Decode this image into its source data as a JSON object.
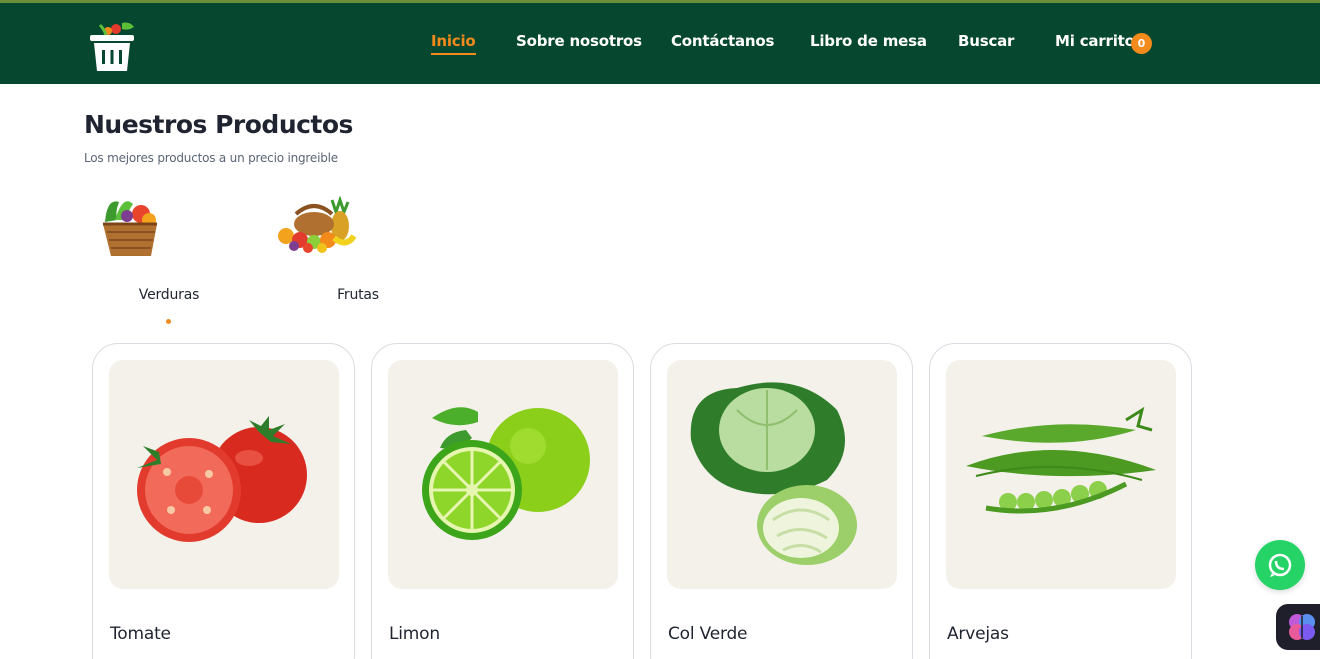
{
  "nav": {
    "items": [
      {
        "label": "Inicio",
        "active": true
      },
      {
        "label": "Sobre nosotros",
        "active": false
      },
      {
        "label": "Contáctanos",
        "active": false
      },
      {
        "label": "Libro de mesa",
        "active": false
      },
      {
        "label": "Buscar",
        "active": false
      },
      {
        "label": "Mi carrito",
        "active": false
      }
    ],
    "cart_count": "0"
  },
  "section": {
    "title": "Nuestros Productos",
    "subtitle": "Los mejores productos a un precio ingreible"
  },
  "categories": [
    {
      "label": "Verduras",
      "icon": "vegetable-basket-icon",
      "selected": true
    },
    {
      "label": "Frutas",
      "icon": "fruit-basket-icon",
      "selected": false
    }
  ],
  "products": [
    {
      "name": "Tomate",
      "image": "tomato-image"
    },
    {
      "name": "Limon",
      "image": "lime-image"
    },
    {
      "name": "Col Verde",
      "image": "cabbage-image"
    },
    {
      "name": "Arvejas",
      "image": "peas-image"
    }
  ],
  "colors": {
    "header_bg": "#06472f",
    "accent": "#f28a1c",
    "whatsapp": "#25d366",
    "card_image_bg": "#f3f1ea"
  },
  "floating": {
    "whatsapp_icon": "whatsapp-icon",
    "assistant_icon": "brain-icon"
  }
}
